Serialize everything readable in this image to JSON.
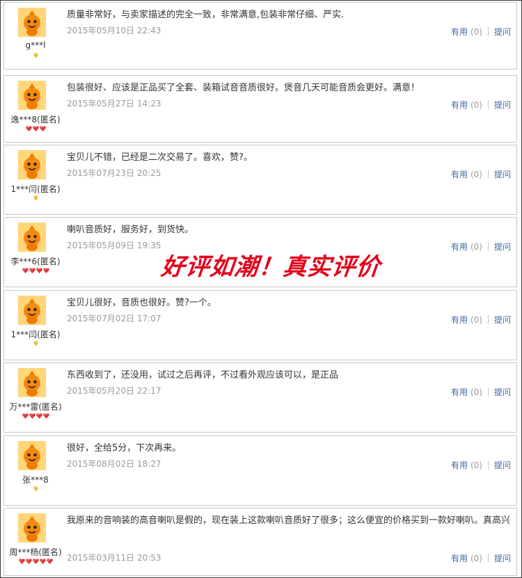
{
  "reviews": [
    {
      "user": "g***l",
      "level": "diamond-1",
      "content": "质量非常好，与卖家描述的完全一致，非常满意,包装非常仔细、严实.",
      "date": "2015年05月10日 22:43"
    },
    {
      "user": "逸***8(匿名)",
      "level": "heart-3",
      "content": "包装很好、应该是正品买了全套、装箱试音音质很好。煲音几天可能音质会更好。满意！",
      "date": "2015年05月27日 14:23"
    },
    {
      "user": "1***闫(匿名)",
      "level": "diamond-1",
      "content": "宝贝儿不错，已经是二次交易了。喜欢，赞?。",
      "date": "2015年07月23日 20:25"
    },
    {
      "user": "李***6(匿名)",
      "level": "heart-4",
      "content": "喇叭音质好，服务好，到货快。",
      "date": "2015年05月09日 19:35"
    },
    {
      "user": "1***闫(匿名)",
      "level": "diamond-1",
      "content": "宝贝儿很好，音质也很好。赞?一个。",
      "date": "2015年07月02日 17:07"
    },
    {
      "user": "万***雷(匿名)",
      "level": "heart-4",
      "content": "东西收到了，还没用，试过之后再评，不过看外观应该可以，是正品",
      "date": "2015年05月20日 22:17"
    },
    {
      "user": "张***8",
      "level": "diamond-1",
      "content": "很好，全给5分，下次再来。",
      "date": "2015年08月02日 18:27"
    },
    {
      "user": "周***杨(匿名)",
      "level": "heart-5",
      "content": "我原来的音响装的高音喇叭是假的，现在装上这款喇叭音质好了很多；这么便宜的价格买到一款好喇叭。真高兴",
      "date": "2015年03月11日 20:53"
    }
  ],
  "actions": {
    "useful_label": "有用",
    "useful_count": "(0)",
    "ask_label": "提问"
  },
  "overlay": {
    "text": "好评如潮！真实评价"
  },
  "colors": {
    "link": "#3c66a5",
    "date": "#9a9a9a",
    "overlay": "#e4001b",
    "heart": "#e03a3a",
    "diamond": "#f2b21a"
  }
}
